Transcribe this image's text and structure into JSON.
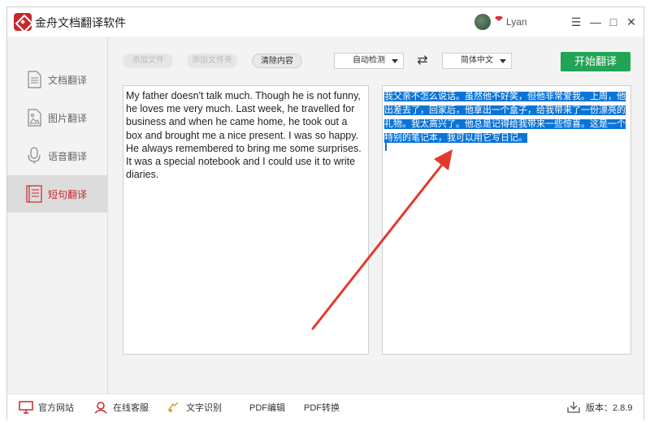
{
  "window": {
    "title": "金舟文档翻译软件",
    "username": "Lyan",
    "controls": {
      "menu": "☰",
      "minimize": "—",
      "maximize": "□",
      "close": "✕"
    }
  },
  "sidebar": {
    "items": [
      {
        "label": "文档翻译",
        "icon": "document-icon",
        "active": false
      },
      {
        "label": "图片翻译",
        "icon": "image-icon",
        "active": false
      },
      {
        "label": "语音翻译",
        "icon": "microphone-icon",
        "active": false
      },
      {
        "label": "短句翻译",
        "icon": "text-lines-icon",
        "active": true
      }
    ]
  },
  "toolbar": {
    "add_file": "添加文件",
    "add_folder": "添加文件夹",
    "clear": "清除内容",
    "source_lang": "自动检测",
    "target_lang": "简体中文",
    "swap_icon": "⇄",
    "start": "开始翻译"
  },
  "source": {
    "text": "My father doesn't talk much. Though he is not funny, he loves me very much. Last week, he travelled for business and when he came home, he took out a box and brought me a nice present. I was so happy. He always remembered to bring me some surprises. It was a special notebook and I could use it to write diaries."
  },
  "target": {
    "text": "我父亲不怎么说话。虽然他不好笑，但他非常爱我。上周，他出差去了，回家后，他拿出一个盒子，给我带来了一份漂亮的礼物。我太高兴了。他总是记得给我带来一些惊喜。这是一个特别的笔记本，我可以用它写日记。"
  },
  "footer": {
    "website": "官方网站",
    "support": "在线客服",
    "ocr": "文字识别",
    "pdf_edit": "PDF编辑",
    "pdf_convert": "PDF转换",
    "version_label": "版本：2.8.9"
  },
  "colors": {
    "brand": "#c8272d",
    "accent_green": "#21a456",
    "selection": "#0a74d8",
    "arrow": "#e23a2f"
  }
}
